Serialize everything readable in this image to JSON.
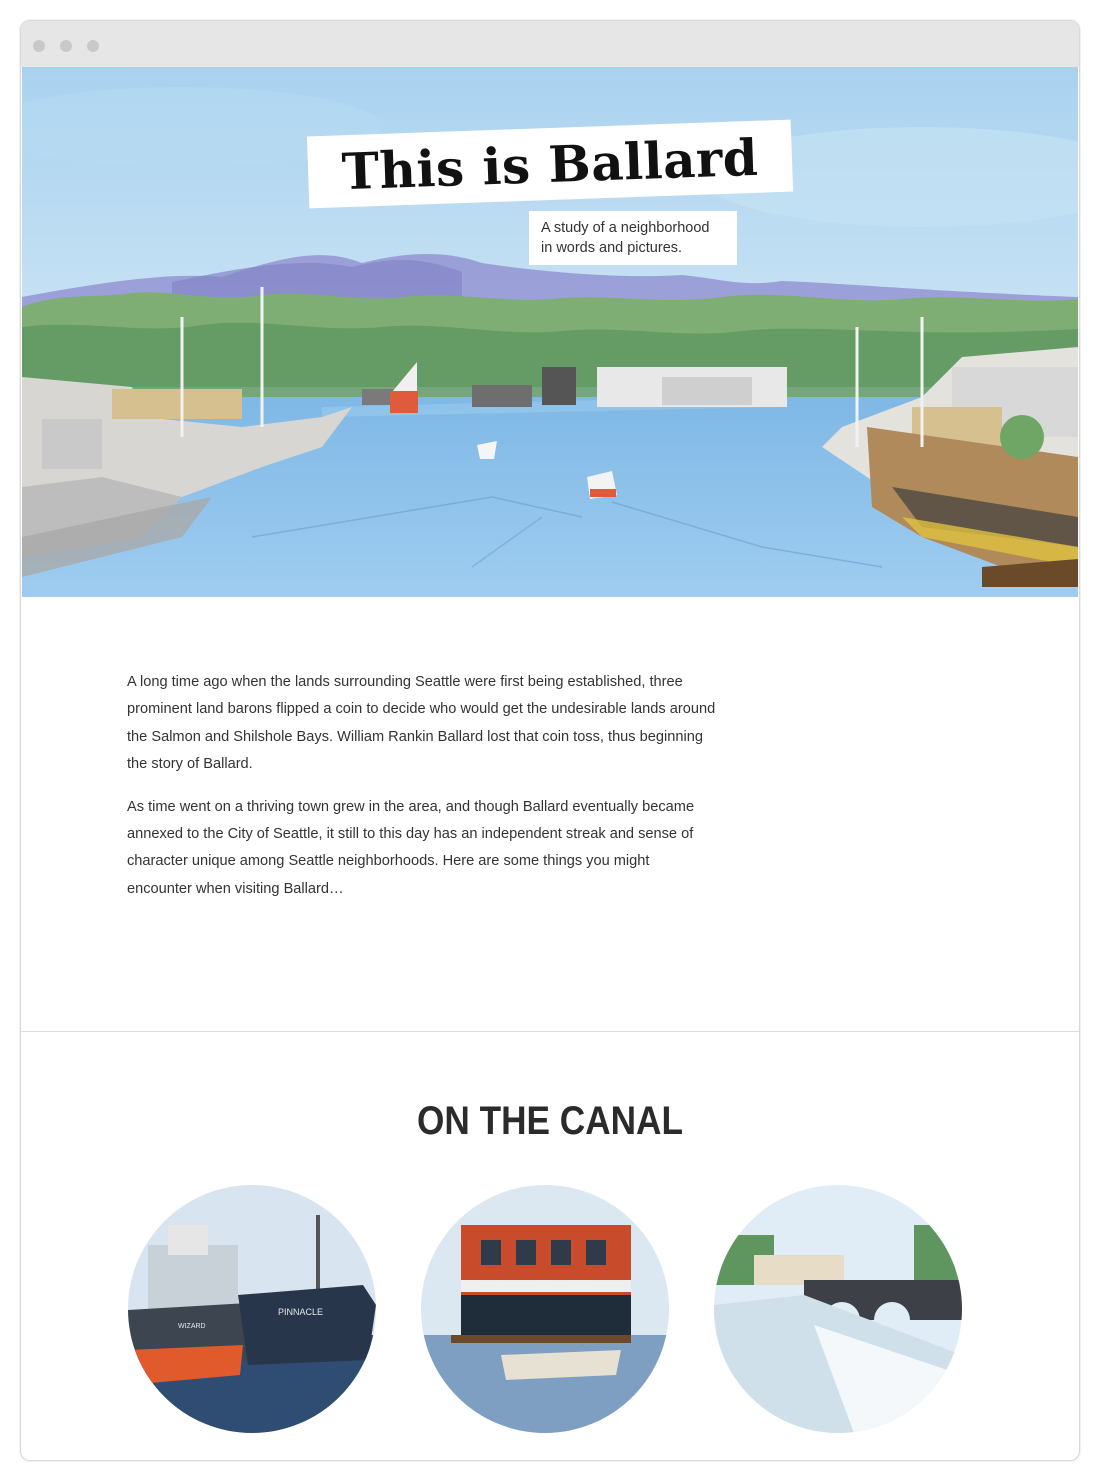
{
  "hero": {
    "title": "This is Ballard",
    "tagline": "A study of a neighborhood in words and pictures.",
    "illustration_icon": "watercolor-canal-landscape"
  },
  "intro": {
    "paragraphs": [
      "A long time ago when the lands surrounding Seattle were first being established, three prominent land barons flipped a coin to decide who would get the undesirable lands around the Salmon and Shilshole Bays. William Rankin Ballard lost that coin toss, thus beginning the story of Ballard.",
      "As time went on a thriving town grew in the area, and though Ballard eventually became annexed to the City of Seattle, it still to this day has an independent streak and sense of character unique among Seattle neighborhoods. Here are some things you might encounter when visiting Ballard…"
    ]
  },
  "section": {
    "heading": "ON THE CANAL",
    "cards": [
      {
        "icon": "fishing-boats-illustration",
        "boat_labels": [
          "WIZARD",
          "PINNACLE"
        ]
      },
      {
        "icon": "houseboat-illustration"
      },
      {
        "icon": "locks-bridge-illustration"
      }
    ]
  },
  "colors": {
    "sky": "#bfdcf0",
    "water": "#8ec3ec",
    "trees": "#7fae74",
    "mountains": "#8f8fcf",
    "heading": "#2b2b2b",
    "body_text": "#333333"
  }
}
